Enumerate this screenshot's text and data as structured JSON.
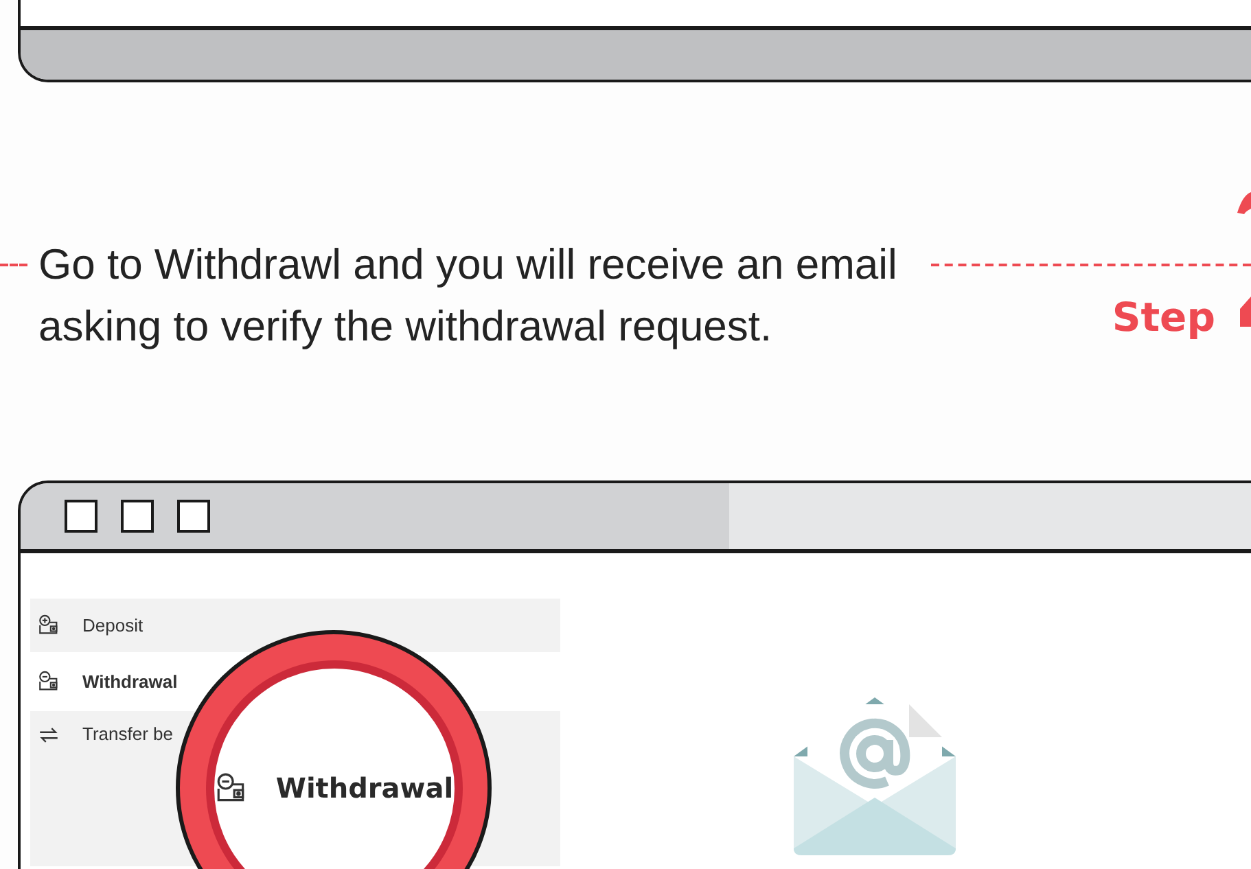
{
  "instruction": "Go to Withdrawl and you will receive an email asking to verify the withdrawal request.",
  "step_label": "Step",
  "browser": {
    "menu": [
      {
        "label": "Deposit",
        "kind": "deposit",
        "selected": false
      },
      {
        "label": "Withdrawal",
        "kind": "withdrawal",
        "selected": true
      },
      {
        "label": "Transfer be",
        "kind": "transfer",
        "selected": false
      }
    ],
    "magnifier": {
      "label": "Withdrawal",
      "kind": "withdrawal"
    }
  }
}
